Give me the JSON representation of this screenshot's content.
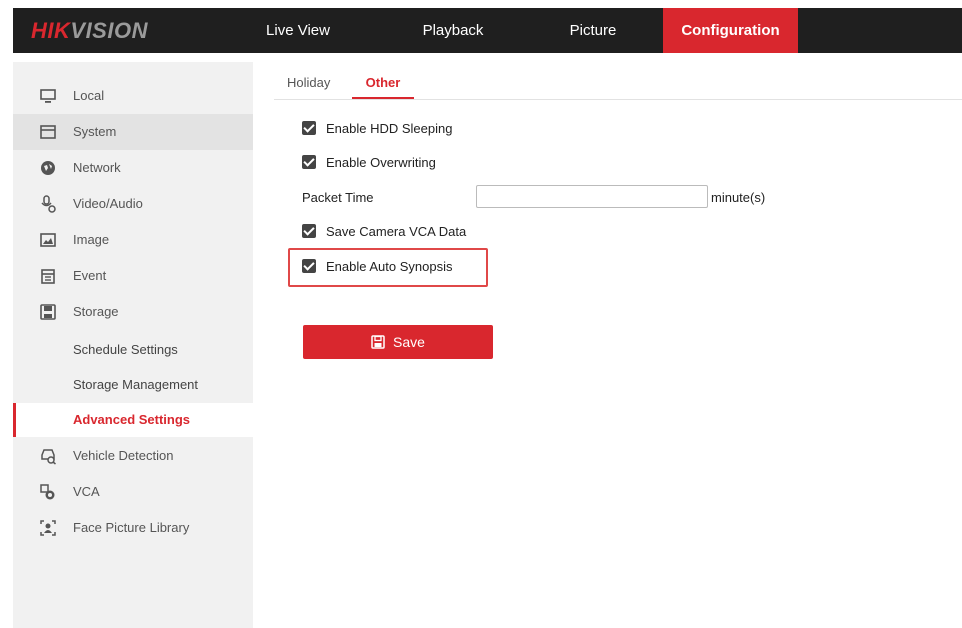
{
  "brand": {
    "hik": "HIK",
    "vision": "VISION"
  },
  "nav": {
    "live_view": "Live View",
    "playback": "Playback",
    "picture": "Picture",
    "configuration": "Configuration"
  },
  "sidebar": {
    "items": [
      {
        "label": "Local",
        "icon": "monitor-icon"
      },
      {
        "label": "System",
        "icon": "system-icon"
      },
      {
        "label": "Network",
        "icon": "globe-icon"
      },
      {
        "label": "Video/Audio",
        "icon": "video-audio-icon"
      },
      {
        "label": "Image",
        "icon": "image-icon"
      },
      {
        "label": "Event",
        "icon": "calendar-icon"
      },
      {
        "label": "Storage",
        "icon": "storage-icon"
      }
    ],
    "storage_sub": [
      {
        "label": "Schedule Settings"
      },
      {
        "label": "Storage Management"
      },
      {
        "label": "Advanced Settings"
      }
    ],
    "items_after": [
      {
        "label": "Vehicle Detection",
        "icon": "vehicle-icon"
      },
      {
        "label": "VCA",
        "icon": "vca-icon"
      },
      {
        "label": "Face Picture Library",
        "icon": "face-library-icon"
      }
    ]
  },
  "tabs": {
    "holiday": "Holiday",
    "other": "Other"
  },
  "form": {
    "enable_hdd_sleeping": "Enable HDD Sleeping",
    "enable_overwriting": "Enable Overwriting",
    "packet_time_label": "Packet Time",
    "packet_time_value": "",
    "packet_time_unit": "minute(s)",
    "save_camera_vca": "Save Camera VCA Data",
    "enable_auto_synopsis": "Enable Auto Synopsis",
    "save_label": "Save"
  },
  "colors": {
    "accent": "#d9272e",
    "topbar": "#1f1f1f",
    "sidebar": "#f1f1f1"
  }
}
